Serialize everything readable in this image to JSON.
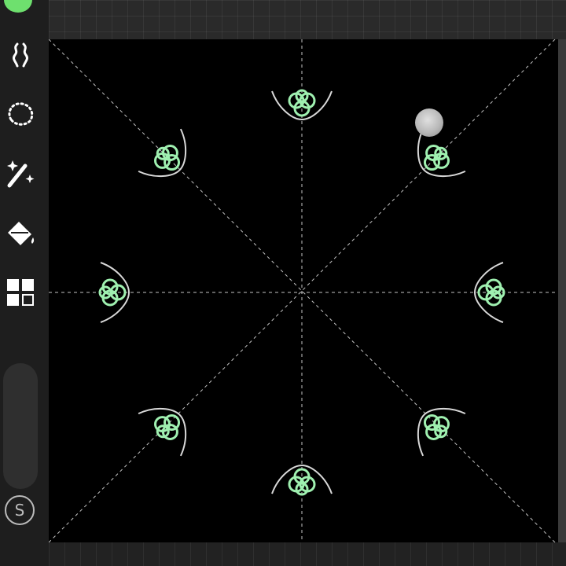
{
  "app": {
    "mode": "symmetry-drawing",
    "canvas_background": "#000000",
    "accent_color": "#6ee06e",
    "stroke_color": "#9ff0b0",
    "guide_color": "#e6e6e6"
  },
  "sidebar": {
    "current_color": "#6ee06e",
    "tools": [
      {
        "name": "symmetry-icon"
      },
      {
        "name": "lasso-select-icon"
      },
      {
        "name": "magic-wand-icon"
      },
      {
        "name": "paint-bucket-icon"
      },
      {
        "name": "layers-grid-icon"
      }
    ],
    "bottom_button": {
      "name": "s-circle-icon",
      "label": "S"
    }
  },
  "canvas": {
    "symmetry": {
      "type": "radial",
      "axes": 8
    }
  }
}
